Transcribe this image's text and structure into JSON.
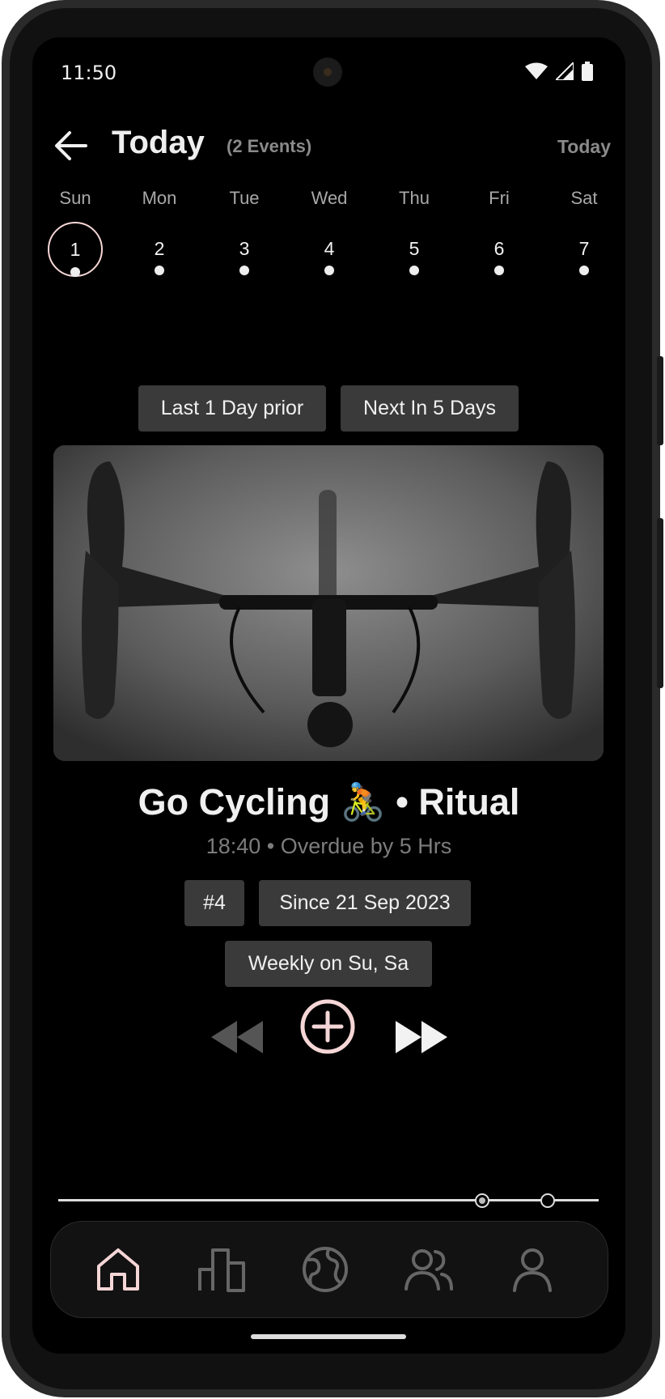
{
  "status_bar": {
    "time": "11:50"
  },
  "header": {
    "title": "Today",
    "subtitle": "(2 Events)",
    "today_link": "Today"
  },
  "week": [
    {
      "name": "Sun",
      "num": "1",
      "selected": true
    },
    {
      "name": "Mon",
      "num": "2"
    },
    {
      "name": "Tue",
      "num": "3"
    },
    {
      "name": "Wed",
      "num": "4"
    },
    {
      "name": "Thu",
      "num": "5"
    },
    {
      "name": "Fri",
      "num": "6"
    },
    {
      "name": "Sat",
      "num": "7"
    }
  ],
  "navigation_chips": {
    "prev": "Last 1 Day prior",
    "next": "Next In 5 Days"
  },
  "event": {
    "title": "Go Cycling 🚴 • Ritual",
    "meta": "18:40 • Overdue by 5 Hrs",
    "tags": {
      "count": "#4",
      "since": "Since 21 Sep 2023",
      "repeat": "Weekly on Su, Sa"
    },
    "image": "bicycle-handlebar-photo"
  },
  "controls": [
    "rewind-icon",
    "add-circle-icon",
    "fast-forward-icon"
  ],
  "colors": {
    "accent": "#f5d6d6",
    "background": "#000000",
    "chip": "#3a3a3a"
  },
  "bottom_nav": [
    {
      "name": "home-icon",
      "active": true
    },
    {
      "name": "stats-icon"
    },
    {
      "name": "globe-icon"
    },
    {
      "name": "people-icon"
    },
    {
      "name": "profile-icon"
    }
  ]
}
